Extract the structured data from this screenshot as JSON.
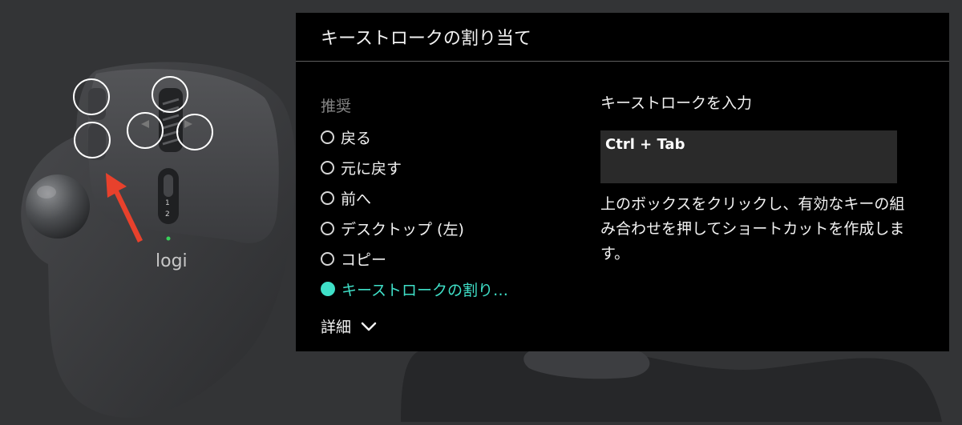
{
  "colors": {
    "accent": "#3fe0c8",
    "panel_bg": "#000000",
    "page_bg": "#333436",
    "arrow": "#e8412c"
  },
  "mouse": {
    "logo_text": "logi",
    "mode_labels": [
      "1",
      "2"
    ]
  },
  "panel": {
    "title": "キーストロークの割り当て",
    "recommended_heading": "推奨",
    "options": [
      {
        "label": "戻る",
        "selected": false
      },
      {
        "label": "元に戻す",
        "selected": false
      },
      {
        "label": "前へ",
        "selected": false
      },
      {
        "label": "デスクトップ (左)",
        "selected": false
      },
      {
        "label": "コピー",
        "selected": false
      },
      {
        "label": "キーストロークの割り…",
        "selected": true
      }
    ],
    "more_label": "詳細",
    "more_icon": "chevron-down-icon",
    "input_label": "キーストロークを入力",
    "input_value": "Ctrl + Tab",
    "help_text": "上のボックスをクリックし、有効なキーの組み合わせを押してショートカットを作成します。"
  }
}
